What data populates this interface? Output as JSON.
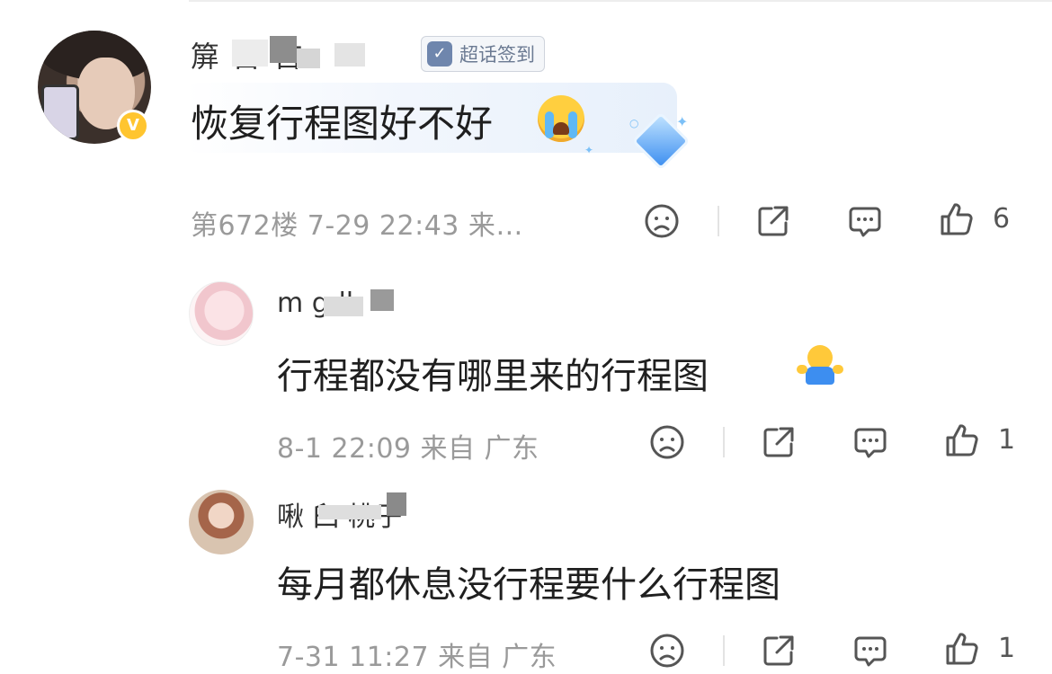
{
  "main_comment": {
    "username_visible": "箳 首 首",
    "badge_label": "超话签到",
    "verified_mark": "V",
    "text": "恢复行程图好不好",
    "emoji": "crying-face-emoji",
    "meta": "第672楼 7-29 22:43 来…",
    "like_count": "6"
  },
  "replies": [
    {
      "username_visible": "m gdh",
      "text": "行程都没有哪里来的行程图",
      "emoji": "shrug-emoji",
      "meta": "8-1 22:09 来自 广东",
      "like_count": "1"
    },
    {
      "username_visible": "啾 臼 桃子",
      "text": "每月都休息没行程要什么行程图",
      "meta": "7-31 11:27 来自 广东",
      "like_count": "1"
    }
  ],
  "colors": {
    "meta_gray": "#9a9a9a",
    "verified_gold": "#ffc52f",
    "badge_blue": "#6f86ad"
  }
}
